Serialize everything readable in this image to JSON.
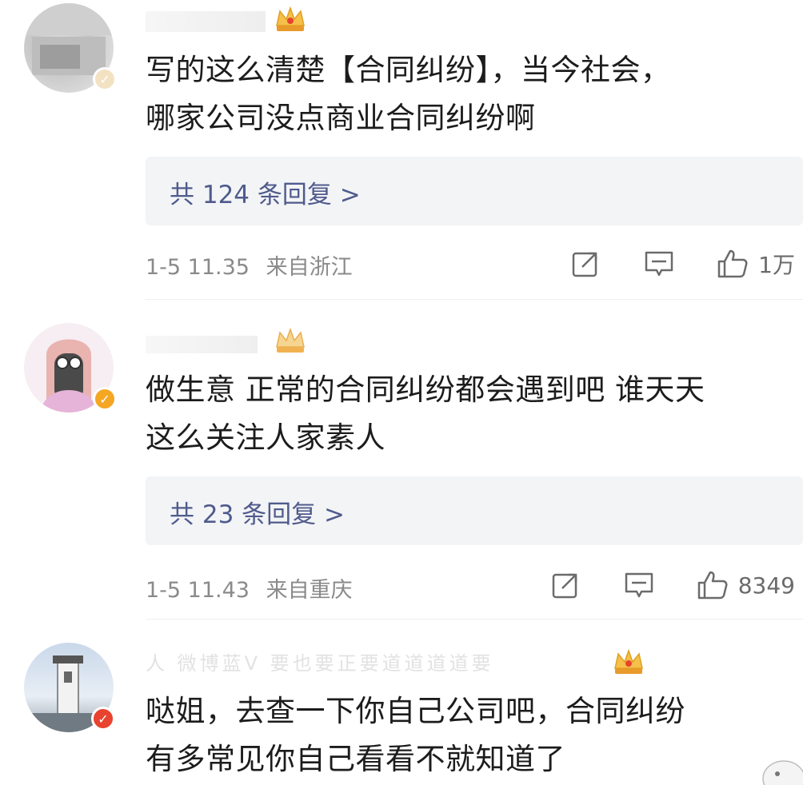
{
  "comments": [
    {
      "text_line1": "写的这么清楚【合同纠纷】，当今社会，",
      "text_line2": "哪家公司没点商业合同纠纷啊",
      "reply_label": "共 124 条回复 >",
      "time": "1-5 11.35",
      "location": "来自浙江",
      "likes": "1万"
    },
    {
      "text_line1": "做生意 正常的合同纠纷都会遇到吧 谁天天",
      "text_line2": "这么关注人家素人",
      "reply_label": "共 23 条回复 >",
      "time": "1-5 11.43",
      "location": "来自重庆",
      "likes": "8349"
    },
    {
      "username_fragment": "人  微博蓝V 要也要正要道道道道要",
      "text_line1": "哒姐，去查一下你自己公司吧，合同纠纷",
      "text_line2": "有多常见你自己看看不就知道了"
    }
  ],
  "icons": {
    "share": "share-icon",
    "comment": "comment-icon",
    "like": "thumbs-up-icon",
    "verified": "verified-badge-icon",
    "crown": "crown-badge-icon"
  },
  "colors": {
    "reply_link": "#4f5b8c",
    "meta_gray": "#8a8a8a",
    "reply_bg": "#f3f4f6",
    "verified_orange": "#f5a623",
    "verified_red": "#e8432f"
  }
}
